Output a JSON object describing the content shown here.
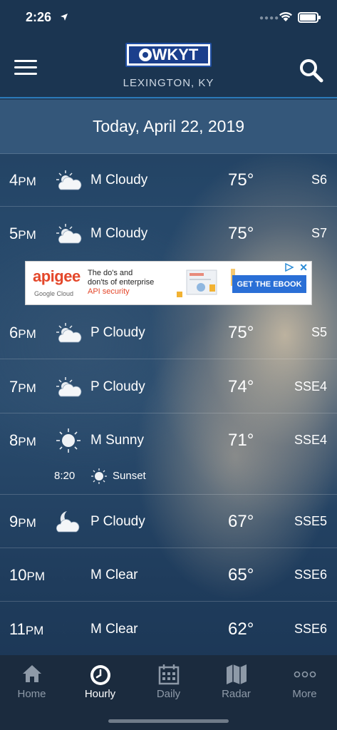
{
  "status_bar": {
    "time": "2:26",
    "location_arrow": "location-arrow-icon"
  },
  "header": {
    "logo_text": "WKYT",
    "location": "LEXINGTON, KY",
    "menu_icon": "hamburger-menu-icon",
    "search_icon": "search-icon"
  },
  "date_label": "Today, April 22, 2019",
  "hours": [
    {
      "hour": "4",
      "ampm": "PM",
      "icon": "partly-cloudy-day-icon",
      "condition": "M Cloudy",
      "temp": "75°",
      "wind": "S6"
    },
    {
      "hour": "5",
      "ampm": "PM",
      "icon": "partly-cloudy-day-icon",
      "condition": "M Cloudy",
      "temp": "75°",
      "wind": "S7"
    },
    {
      "hour": "6",
      "ampm": "PM",
      "icon": "partly-cloudy-day-icon",
      "condition": "P Cloudy",
      "temp": "75°",
      "wind": "S5"
    },
    {
      "hour": "7",
      "ampm": "PM",
      "icon": "partly-cloudy-day-icon",
      "condition": "P Cloudy",
      "temp": "74°",
      "wind": "SSE4"
    },
    {
      "hour": "8",
      "ampm": "PM",
      "icon": "sunny-icon",
      "condition": "M Sunny",
      "temp": "71°",
      "wind": "SSE4"
    },
    {
      "hour": "9",
      "ampm": "PM",
      "icon": "partly-cloudy-night-icon",
      "condition": "P Cloudy",
      "temp": "67°",
      "wind": "SSE5"
    },
    {
      "hour": "10",
      "ampm": "PM",
      "icon": "moon-icon",
      "condition": "M Clear",
      "temp": "65°",
      "wind": "SSE6"
    },
    {
      "hour": "11",
      "ampm": "PM",
      "icon": "moon-icon",
      "condition": "M Clear",
      "temp": "62°",
      "wind": "SSE6"
    }
  ],
  "sunset": {
    "time": "8:20",
    "label": "Sunset",
    "icon": "sunset-icon"
  },
  "ad": {
    "brand": "apigee",
    "sub": "Google Cloud",
    "line1": "The do's and",
    "line2": "don'ts of enterprise",
    "line3": "API security",
    "cta": "GET THE EBOOK",
    "choice_icon": "ad-choices-icon",
    "close_icon": "close-icon"
  },
  "tabs": [
    {
      "label": "Home",
      "icon": "home-icon"
    },
    {
      "label": "Hourly",
      "icon": "clock-icon"
    },
    {
      "label": "Daily",
      "icon": "calendar-icon"
    },
    {
      "label": "Radar",
      "icon": "map-icon"
    },
    {
      "label": "More",
      "icon": "more-icon"
    }
  ],
  "colors": {
    "header_bg": "#1b3551",
    "accent_line": "#2b79b8",
    "tab_bar_bg": "#1b2b3e",
    "ad_cta": "#2a6fd6",
    "ad_brand": "#e4472a"
  }
}
